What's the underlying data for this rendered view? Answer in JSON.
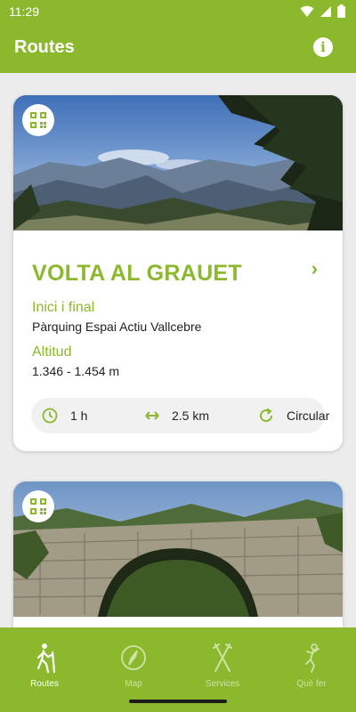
{
  "status_bar": {
    "time": "11:29"
  },
  "app_bar": {
    "title": "Routes",
    "info_icon": "info-icon"
  },
  "routes": [
    {
      "name": "VOLTA AL GRAUET",
      "start_label": "Inici i final",
      "start_value": "Pàrquing Espai Actiu Vallcebre",
      "altitude_label": "Altitud",
      "altitude_value": "1.346 - 1.454 m",
      "duration": "1 h",
      "distance": "2.5 km",
      "type": "Circular"
    }
  ],
  "bottom_nav": [
    {
      "label": "Routes",
      "icon": "hiker-icon",
      "active": true
    },
    {
      "label": "Map",
      "icon": "compass-icon",
      "active": false
    },
    {
      "label": "Services",
      "icon": "fork-knife-icon",
      "active": false
    },
    {
      "label": "Què fer",
      "icon": "climber-icon",
      "active": false
    }
  ],
  "colors": {
    "brand": "#8bb82d",
    "background": "#ececec",
    "card": "#ffffff"
  }
}
